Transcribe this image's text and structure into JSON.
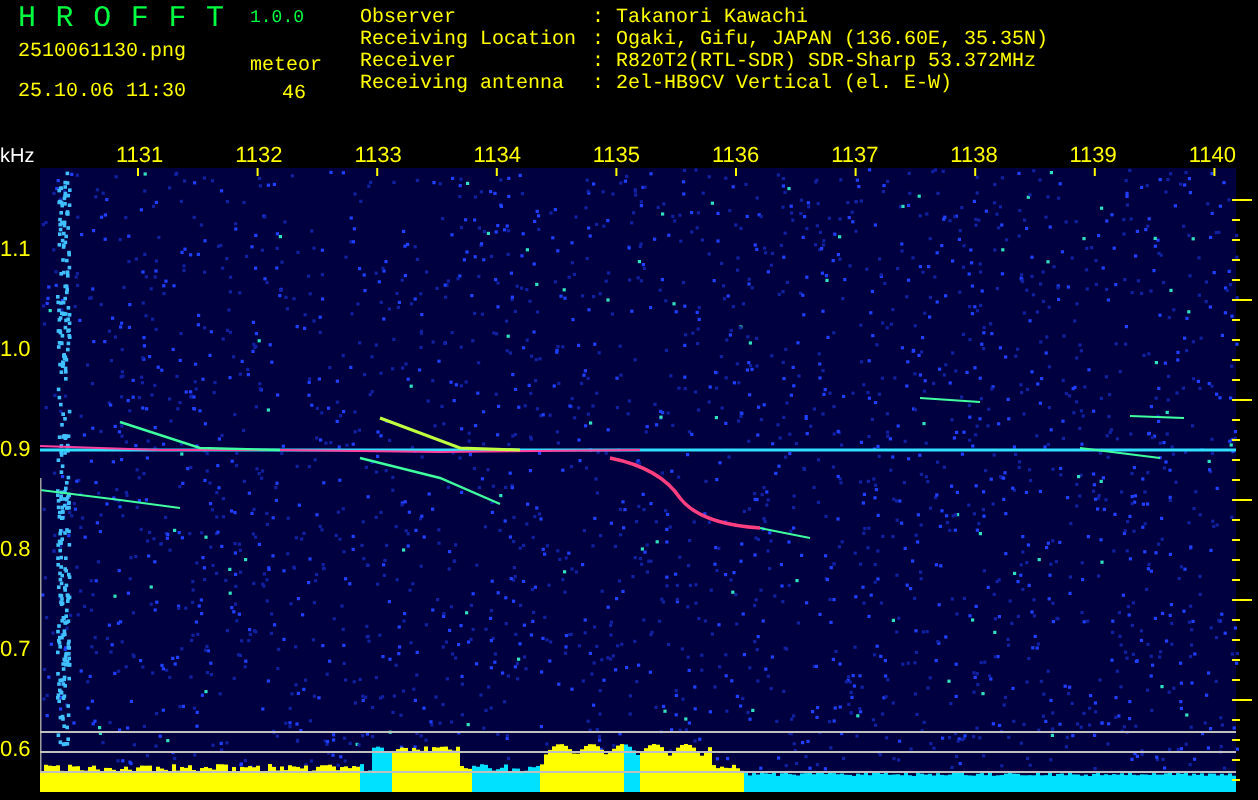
{
  "app": {
    "title": "H R O F F T",
    "version": "1.0.0"
  },
  "file_name": "2510061130.png",
  "timestamp": "25.10.06 11:30",
  "meteor_count": {
    "label": "meteor",
    "value": "46"
  },
  "station_info": [
    {
      "label": "Observer",
      "separator": ":",
      "value": "Takanori Kawachi"
    },
    {
      "label": "Receiving Location",
      "separator": ":",
      "value": "Ogaki, Gifu, JAPAN (136.60E, 35.35N)"
    },
    {
      "label": "Receiver",
      "separator": ":",
      "value": "R820T2(RTL-SDR) SDR-Sharp 53.372MHz"
    },
    {
      "label": "Receiving antenna",
      "separator": ":",
      "value": "2el-HB9CV Vertical (el. E-W)"
    }
  ],
  "spectrogram": {
    "y_unit": "kHz",
    "x_labels": [
      "1131",
      "1132",
      "1133",
      "1134",
      "1135",
      "1136",
      "1137",
      "1138",
      "1139",
      "1140"
    ],
    "y_labels": [
      "1.1",
      "1.0",
      "0.9",
      "0.8",
      "0.7",
      "0.6"
    ]
  }
}
